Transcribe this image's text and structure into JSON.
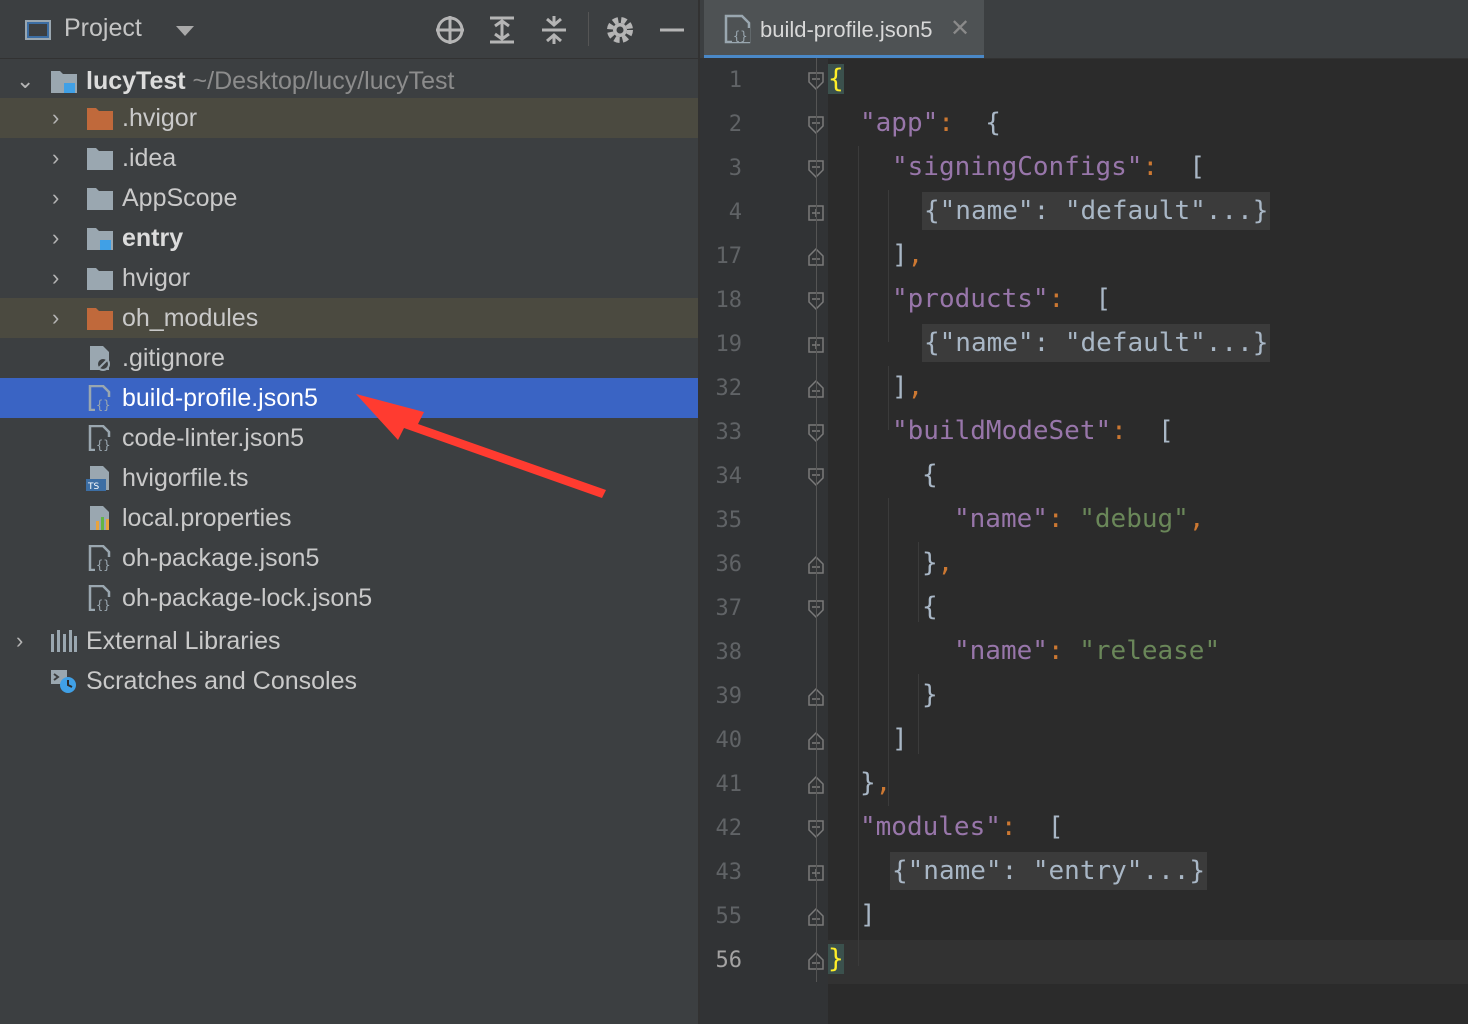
{
  "project_panel": {
    "title": "Project",
    "root": {
      "name": "lucyTest",
      "path": "~/Desktop/lucy/lucyTest"
    },
    "items": [
      {
        "label": ".hvigor",
        "kind": "folder-excluded",
        "expandable": true
      },
      {
        "label": ".idea",
        "kind": "folder",
        "expandable": true
      },
      {
        "label": "AppScope",
        "kind": "folder",
        "expandable": true
      },
      {
        "label": "entry",
        "kind": "module-folder",
        "expandable": true
      },
      {
        "label": "hvigor",
        "kind": "folder",
        "expandable": true
      },
      {
        "label": "oh_modules",
        "kind": "folder-excluded",
        "expandable": true
      },
      {
        "label": ".gitignore",
        "kind": "ignore-file"
      },
      {
        "label": "build-profile.json5",
        "kind": "json-file",
        "selected": true
      },
      {
        "label": "code-linter.json5",
        "kind": "json-file"
      },
      {
        "label": "hvigorfile.ts",
        "kind": "ts-file"
      },
      {
        "label": "local.properties",
        "kind": "properties-file"
      },
      {
        "label": "oh-package.json5",
        "kind": "json-file"
      },
      {
        "label": "oh-package-lock.json5",
        "kind": "json-file"
      }
    ],
    "bottom_items": [
      {
        "label": "External Libraries",
        "icon": "libraries-icon"
      },
      {
        "label": "Scratches and Consoles",
        "icon": "scratches-icon"
      }
    ]
  },
  "editor": {
    "tab_label": "build-profile.json5",
    "current_line": "56",
    "lines": [
      {
        "num": "1",
        "fold": "open"
      },
      {
        "num": "2",
        "fold": "open"
      },
      {
        "num": "3",
        "fold": "open"
      },
      {
        "num": "4",
        "fold": "plus"
      },
      {
        "num": "17",
        "fold": "close"
      },
      {
        "num": "18",
        "fold": "open"
      },
      {
        "num": "19",
        "fold": "plus"
      },
      {
        "num": "32",
        "fold": "close"
      },
      {
        "num": "33",
        "fold": "open"
      },
      {
        "num": "34",
        "fold": "open"
      },
      {
        "num": "35",
        "fold": ""
      },
      {
        "num": "36",
        "fold": "close"
      },
      {
        "num": "37",
        "fold": "open"
      },
      {
        "num": "38",
        "fold": ""
      },
      {
        "num": "39",
        "fold": "close"
      },
      {
        "num": "40",
        "fold": "close"
      },
      {
        "num": "41",
        "fold": "close"
      },
      {
        "num": "42",
        "fold": "open"
      },
      {
        "num": "43",
        "fold": "plus"
      },
      {
        "num": "55",
        "fold": "close"
      },
      {
        "num": "56",
        "fold": "close"
      }
    ],
    "code": {
      "l1_brace": "{",
      "app_key": "\"app\"",
      "app_open": " {",
      "signing_key": "\"signingConfigs\"",
      "bracket_open": " [",
      "name_default_fold": "{\"name\": \"default\"...}",
      "bracket_close": "]",
      "comma": ",",
      "products_key": "\"products\"",
      "buildmode_key": "\"buildModeSet\"",
      "obj_open": "{",
      "name_key": "\"name\"",
      "debug_val": "\"debug\"",
      "obj_close": "}",
      "release_val": "\"release\"",
      "modules_key": "\"modules\"",
      "name_entry_fold": "{\"name\": \"entry\"...}",
      "colon": ": ",
      "l56_brace": "}"
    }
  },
  "annotation": {
    "arrow_color": "#ff3b30",
    "target": "build-profile.json5"
  }
}
